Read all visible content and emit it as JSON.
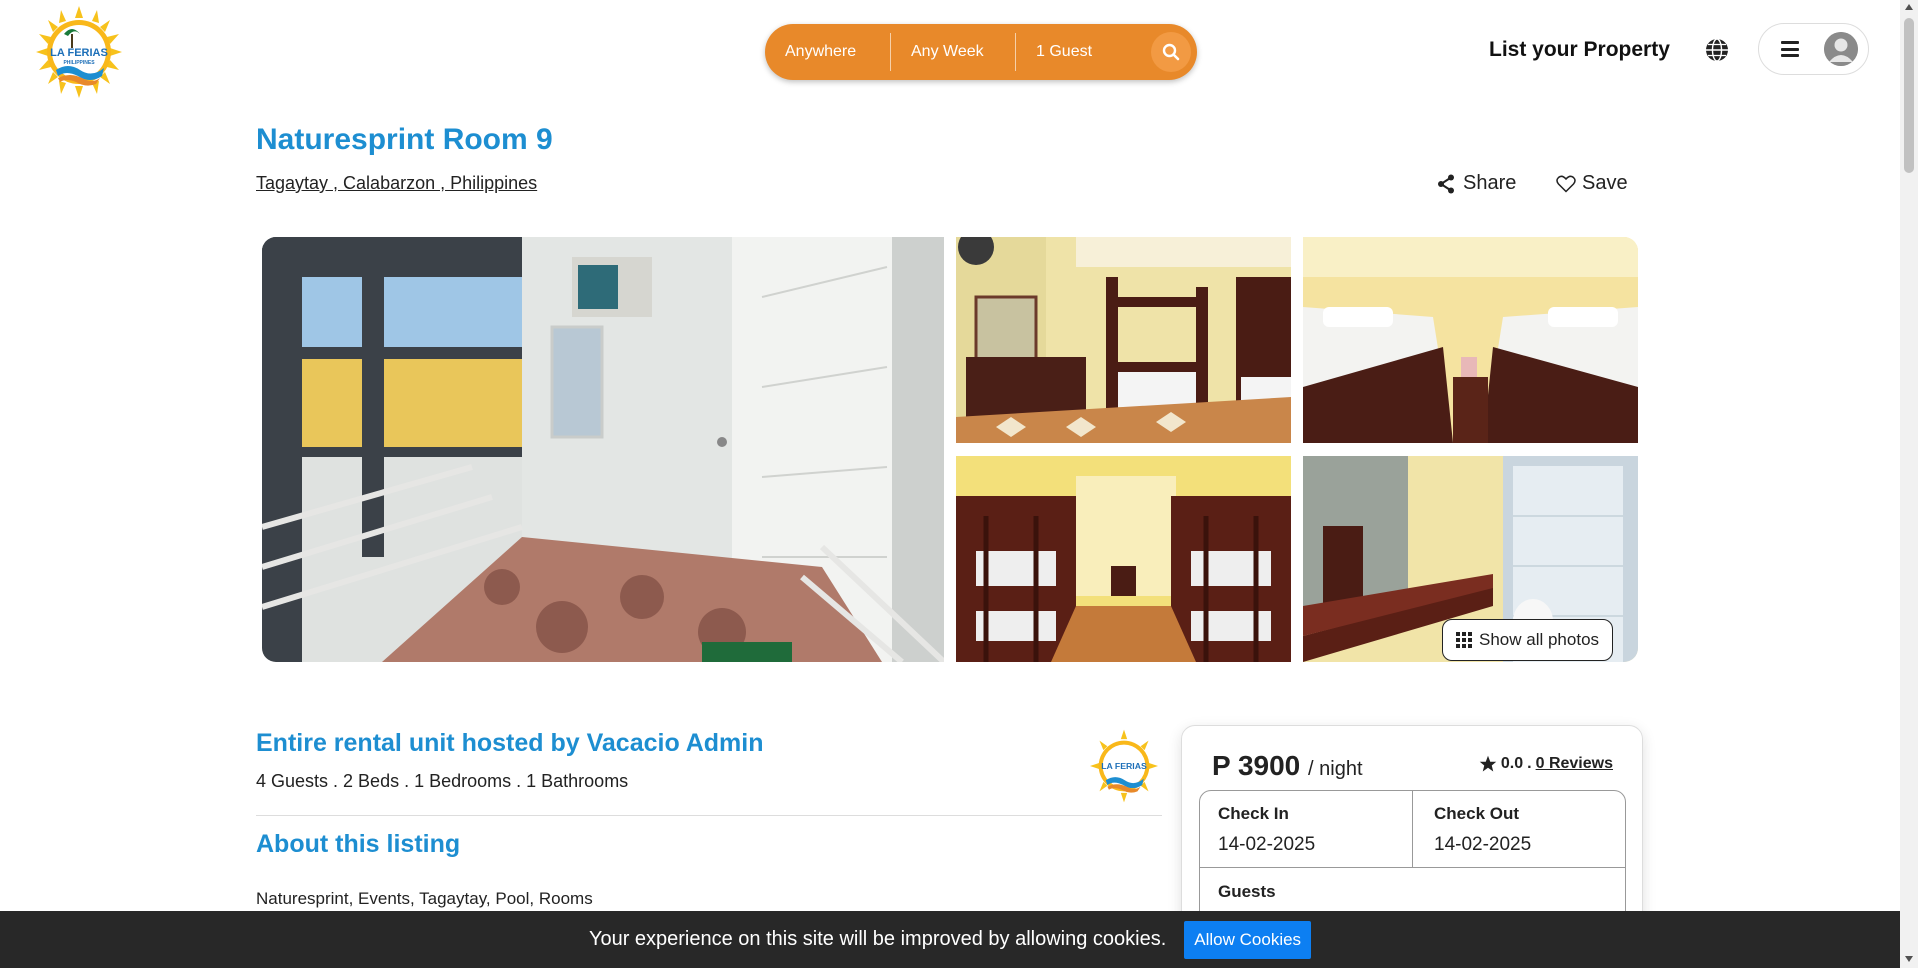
{
  "header": {
    "logo_alt": "LA FERIAS",
    "logo_sub": "PHILIPPINES",
    "search": {
      "where": "Anywhere",
      "when": "Any Week",
      "guests": "1 Guest"
    },
    "list_property": "List your Property"
  },
  "listing": {
    "title": "Naturesprint Room 9",
    "location": "Tagaytay , Calabarzon , Philippines",
    "share_label": "Share",
    "save_label": "Save",
    "show_all_photos": "Show all photos"
  },
  "host": {
    "title": "Entire rental unit hosted by Vacacio Admin",
    "meta": "4 Guests . 2 Beds . 1 Bedrooms . 1 Bathrooms"
  },
  "about": {
    "title": "About this listing",
    "text": "Naturesprint, Events, Tagaytay, Pool, Rooms"
  },
  "booking": {
    "price": "P 3900",
    "per_night": "/ night",
    "rating": "0.0",
    "separator": ".",
    "reviews": "0 Reviews",
    "check_in_label": "Check In",
    "check_in_value": "14-02-2025",
    "check_out_label": "Check Out",
    "check_out_value": "14-02-2025",
    "guests_label": "Guests"
  },
  "cookie": {
    "text": "Your experience on this site will be improved by allowing cookies.",
    "button": "Allow Cookies"
  },
  "colors": {
    "accent_blue": "#1d8ed1",
    "search_orange": "#e8892a",
    "cookie_button": "#0d7ff2"
  },
  "icons": [
    "search-icon",
    "globe-icon",
    "menu-icon",
    "user-avatar-icon",
    "share-icon",
    "heart-icon",
    "grid-icon",
    "star-icon"
  ]
}
